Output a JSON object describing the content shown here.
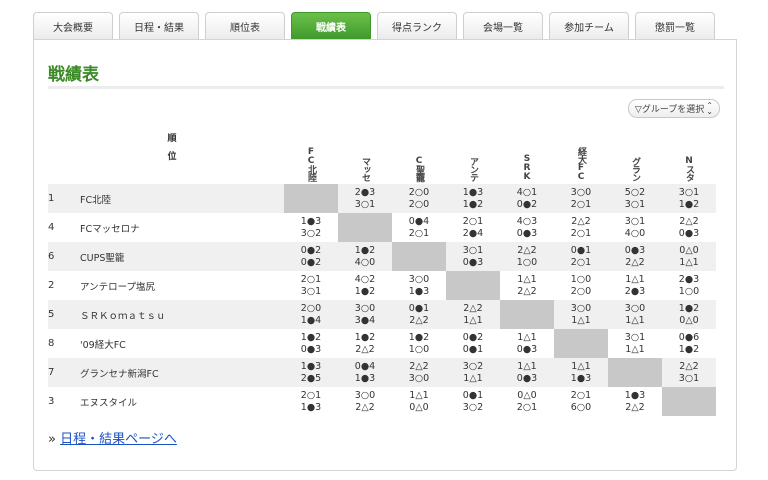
{
  "tabs": [
    {
      "label": "大会概要",
      "active": false
    },
    {
      "label": "日程・結果",
      "active": false
    },
    {
      "label": "順位表",
      "active": false
    },
    {
      "label": "戦績表",
      "active": true
    },
    {
      "label": "得点ランク",
      "active": false
    },
    {
      "label": "会場一覧",
      "active": false
    },
    {
      "label": "参加チーム",
      "active": false
    },
    {
      "label": "懲罰一覧",
      "active": false
    }
  ],
  "page_title": "戦績表",
  "group_select": {
    "icon": "triangle-down-icon",
    "label": "▽グループを選択",
    "chevron": "⌃⌄"
  },
  "table": {
    "rank_header": [
      "順",
      "位"
    ],
    "column_headers": [
      "FC北陸",
      "マッセ",
      "C聖籠",
      "アンテ",
      "SRK",
      "経大FC",
      "グラン",
      "Nスタ"
    ],
    "rows": [
      {
        "rank": "1",
        "team": "FC北陸",
        "results": [
          null,
          [
            "2●3",
            "3○1"
          ],
          [
            "2○0",
            "2○0"
          ],
          [
            "1●3",
            "1●2"
          ],
          [
            "4○1",
            "0●2"
          ],
          [
            "3○0",
            "2○1"
          ],
          [
            "5○2",
            "3○1"
          ],
          [
            "3○1",
            "1●2"
          ]
        ]
      },
      {
        "rank": "4",
        "team": "FCマッセロナ",
        "results": [
          [
            "1●3",
            "3○2"
          ],
          null,
          [
            "0●4",
            "2○1"
          ],
          [
            "2○1",
            "2●4"
          ],
          [
            "4○3",
            "0●3"
          ],
          [
            "2△2",
            "2○1"
          ],
          [
            "3○1",
            "4○0"
          ],
          [
            "2△2",
            "0●3"
          ]
        ]
      },
      {
        "rank": "6",
        "team": "CUPS聖籠",
        "results": [
          [
            "0●2",
            "0●2"
          ],
          [
            "1●2",
            "4○0"
          ],
          null,
          [
            "3○1",
            "0●3"
          ],
          [
            "2△2",
            "1○0"
          ],
          [
            "0●1",
            "2○1"
          ],
          [
            "0●3",
            "2△2"
          ],
          [
            "0△0",
            "1△1"
          ]
        ]
      },
      {
        "rank": "2",
        "team": "アンテロープ塩尻",
        "results": [
          [
            "2○1",
            "3○1"
          ],
          [
            "4○2",
            "1●2"
          ],
          [
            "3○0",
            "1●3"
          ],
          null,
          [
            "1△1",
            "2△2"
          ],
          [
            "1○0",
            "2○0"
          ],
          [
            "1△1",
            "2●3"
          ],
          [
            "2●3",
            "1○0"
          ]
        ]
      },
      {
        "rank": "5",
        "team": "ＳＲＫｏｍａｔｓｕ",
        "results": [
          [
            "2○0",
            "1●4"
          ],
          [
            "3○0",
            "3●4"
          ],
          [
            "0●1",
            "2△2"
          ],
          [
            "2△2",
            "1△1"
          ],
          null,
          [
            "3○0",
            "1△1"
          ],
          [
            "3○0",
            "1△1"
          ],
          [
            "1●2",
            "0△0"
          ]
        ]
      },
      {
        "rank": "8",
        "team": "'09経大FC",
        "results": [
          [
            "1●2",
            "0●3"
          ],
          [
            "1●2",
            "2△2"
          ],
          [
            "1●2",
            "1○0"
          ],
          [
            "0●2",
            "0●1"
          ],
          [
            "1△1",
            "0●3"
          ],
          null,
          [
            "3○1",
            "1△1"
          ],
          [
            "0●6",
            "1●2"
          ]
        ]
      },
      {
        "rank": "7",
        "team": "グランセナ新潟FC",
        "results": [
          [
            "1●3",
            "2●5"
          ],
          [
            "0●4",
            "1●3"
          ],
          [
            "2△2",
            "3○0"
          ],
          [
            "3○2",
            "1△1"
          ],
          [
            "1△1",
            "0●3"
          ],
          [
            "1△1",
            "1●3"
          ],
          null,
          [
            "2△2",
            "3○1"
          ]
        ]
      },
      {
        "rank": "3",
        "team": "エヌスタイル",
        "results": [
          [
            "2○1",
            "1●3"
          ],
          [
            "3○0",
            "2△2"
          ],
          [
            "1△1",
            "0△0"
          ],
          [
            "0●1",
            "3○2"
          ],
          [
            "0△0",
            "2○1"
          ],
          [
            "2○1",
            "6○0"
          ],
          [
            "1●3",
            "2△2"
          ],
          null
        ]
      }
    ]
  },
  "footer_link": {
    "prefix": "»",
    "label": "日程・結果ページへ"
  },
  "colors": {
    "accent": "#3f9a2b",
    "title": "#3a8b25",
    "link": "#1a52c4",
    "self_cell": "#c8c8c8",
    "stripe": "#f0f0f0"
  }
}
